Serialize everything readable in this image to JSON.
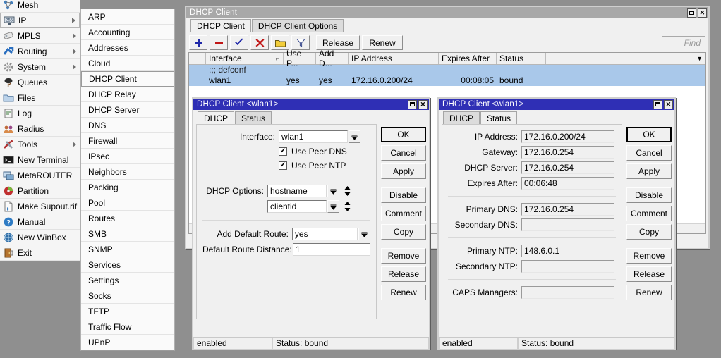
{
  "menu_main": {
    "items": [
      {
        "label": "Mesh",
        "icon": "mesh-icon",
        "arrow": false,
        "selected": false
      },
      {
        "label": "IP",
        "icon": "ip-icon",
        "arrow": true,
        "selected": true
      },
      {
        "label": "MPLS",
        "icon": "mpls-icon",
        "arrow": true,
        "selected": false
      },
      {
        "label": "Routing",
        "icon": "routing-icon",
        "arrow": true,
        "selected": false
      },
      {
        "label": "System",
        "icon": "system-icon",
        "arrow": true,
        "selected": false
      },
      {
        "label": "Queues",
        "icon": "queues-icon",
        "arrow": false,
        "selected": false
      },
      {
        "label": "Files",
        "icon": "files-icon",
        "arrow": false,
        "selected": false
      },
      {
        "label": "Log",
        "icon": "log-icon",
        "arrow": false,
        "selected": false
      },
      {
        "label": "Radius",
        "icon": "radius-icon",
        "arrow": false,
        "selected": false
      },
      {
        "label": "Tools",
        "icon": "tools-icon",
        "arrow": true,
        "selected": false
      },
      {
        "label": "New Terminal",
        "icon": "terminal-icon",
        "arrow": false,
        "selected": false
      },
      {
        "label": "MetaROUTER",
        "icon": "metarouter-icon",
        "arrow": false,
        "selected": false
      },
      {
        "label": "Partition",
        "icon": "partition-icon",
        "arrow": false,
        "selected": false
      },
      {
        "label": "Make Supout.rif",
        "icon": "supout-icon",
        "arrow": false,
        "selected": false
      },
      {
        "label": "Manual",
        "icon": "manual-icon",
        "arrow": false,
        "selected": false
      },
      {
        "label": "New WinBox",
        "icon": "winbox-icon",
        "arrow": false,
        "selected": false
      },
      {
        "label": "Exit",
        "icon": "exit-icon",
        "arrow": false,
        "selected": false
      }
    ]
  },
  "menu_sub": {
    "items": [
      {
        "label": "ARP",
        "selected": false
      },
      {
        "label": "Accounting",
        "selected": false
      },
      {
        "label": "Addresses",
        "selected": false
      },
      {
        "label": "Cloud",
        "selected": false
      },
      {
        "label": "DHCP Client",
        "selected": true
      },
      {
        "label": "DHCP Relay",
        "selected": false
      },
      {
        "label": "DHCP Server",
        "selected": false
      },
      {
        "label": "DNS",
        "selected": false
      },
      {
        "label": "Firewall",
        "selected": false
      },
      {
        "label": "IPsec",
        "selected": false
      },
      {
        "label": "Neighbors",
        "selected": false
      },
      {
        "label": "Packing",
        "selected": false
      },
      {
        "label": "Pool",
        "selected": false
      },
      {
        "label": "Routes",
        "selected": false
      },
      {
        "label": "SMB",
        "selected": false
      },
      {
        "label": "SNMP",
        "selected": false
      },
      {
        "label": "Services",
        "selected": false
      },
      {
        "label": "Settings",
        "selected": false
      },
      {
        "label": "Socks",
        "selected": false
      },
      {
        "label": "TFTP",
        "selected": false
      },
      {
        "label": "Traffic Flow",
        "selected": false
      },
      {
        "label": "UPnP",
        "selected": false
      }
    ]
  },
  "main_window": {
    "title": "DHCP Client",
    "tabs": [
      {
        "label": "DHCP Client",
        "active": true
      },
      {
        "label": "DHCP Client Options",
        "active": false
      }
    ],
    "toolbar": {
      "icons": [
        "plus-icon",
        "minus-icon",
        "check-icon",
        "cross-icon",
        "folder-icon",
        "filter-icon"
      ],
      "release_label": "Release",
      "renew_label": "Renew",
      "find_placeholder": "Find"
    },
    "table": {
      "columns": [
        "Interface",
        "Use P...",
        "Add D...",
        "IP Address",
        "Expires After",
        "Status"
      ],
      "sort_column": "Interface",
      "comment_row": ";;; defconf",
      "rows": [
        {
          "interface": "wlan1",
          "use_peer_dns": "yes",
          "add_default_route": "yes",
          "ip_address": "172.16.0.200/24",
          "expires_after": "00:08:05",
          "status": "bound",
          "selected": true
        }
      ]
    }
  },
  "dialog_dhcp": {
    "title": "DHCP Client <wlan1>",
    "tabs": [
      {
        "label": "DHCP",
        "active": true
      },
      {
        "label": "Status",
        "active": false
      }
    ],
    "fields": {
      "interface_label": "Interface:",
      "interface_value": "wlan1",
      "use_peer_dns_label": "Use Peer DNS",
      "use_peer_dns_checked": true,
      "use_peer_ntp_label": "Use Peer NTP",
      "use_peer_ntp_checked": true,
      "dhcp_options_label": "DHCP Options:",
      "dhcp_option_1": "hostname",
      "dhcp_option_2": "clientid",
      "add_default_route_label": "Add Default Route:",
      "add_default_route_value": "yes",
      "default_route_distance_label": "Default Route Distance:",
      "default_route_distance_value": "1"
    },
    "buttons": [
      "OK",
      "Cancel",
      "Apply",
      "Disable",
      "Comment",
      "Copy",
      "Remove",
      "Release",
      "Renew"
    ],
    "status": {
      "enabled": "enabled",
      "state": "Status: bound"
    }
  },
  "dialog_status": {
    "title": "DHCP Client <wlan1>",
    "tabs": [
      {
        "label": "DHCP",
        "active": false
      },
      {
        "label": "Status",
        "active": true
      }
    ],
    "fields": [
      {
        "label": "IP Address:",
        "value": "172.16.0.200/24"
      },
      {
        "label": "Gateway:",
        "value": "172.16.0.254"
      },
      {
        "label": "DHCP Server:",
        "value": "172.16.0.254"
      },
      {
        "label": "Expires After:",
        "value": "00:06:48"
      },
      {
        "label": "Primary DNS:",
        "value": "172.16.0.254"
      },
      {
        "label": "Secondary DNS:",
        "value": ""
      },
      {
        "label": "Primary NTP:",
        "value": "148.6.0.1"
      },
      {
        "label": "Secondary NTP:",
        "value": ""
      },
      {
        "label": "CAPS Managers:",
        "value": ""
      }
    ],
    "buttons": [
      "OK",
      "Cancel",
      "Apply",
      "Disable",
      "Comment",
      "Copy",
      "Remove",
      "Release",
      "Renew"
    ],
    "status": {
      "enabled": "enabled",
      "state": "Status: bound"
    }
  },
  "colors": {
    "titlebar_active": "#2f2fb5",
    "titlebar_inactive": "#a8a8a8",
    "selection": "#a9c8ea",
    "desktop": "#8f8f8f",
    "face": "#f0f0f0"
  }
}
